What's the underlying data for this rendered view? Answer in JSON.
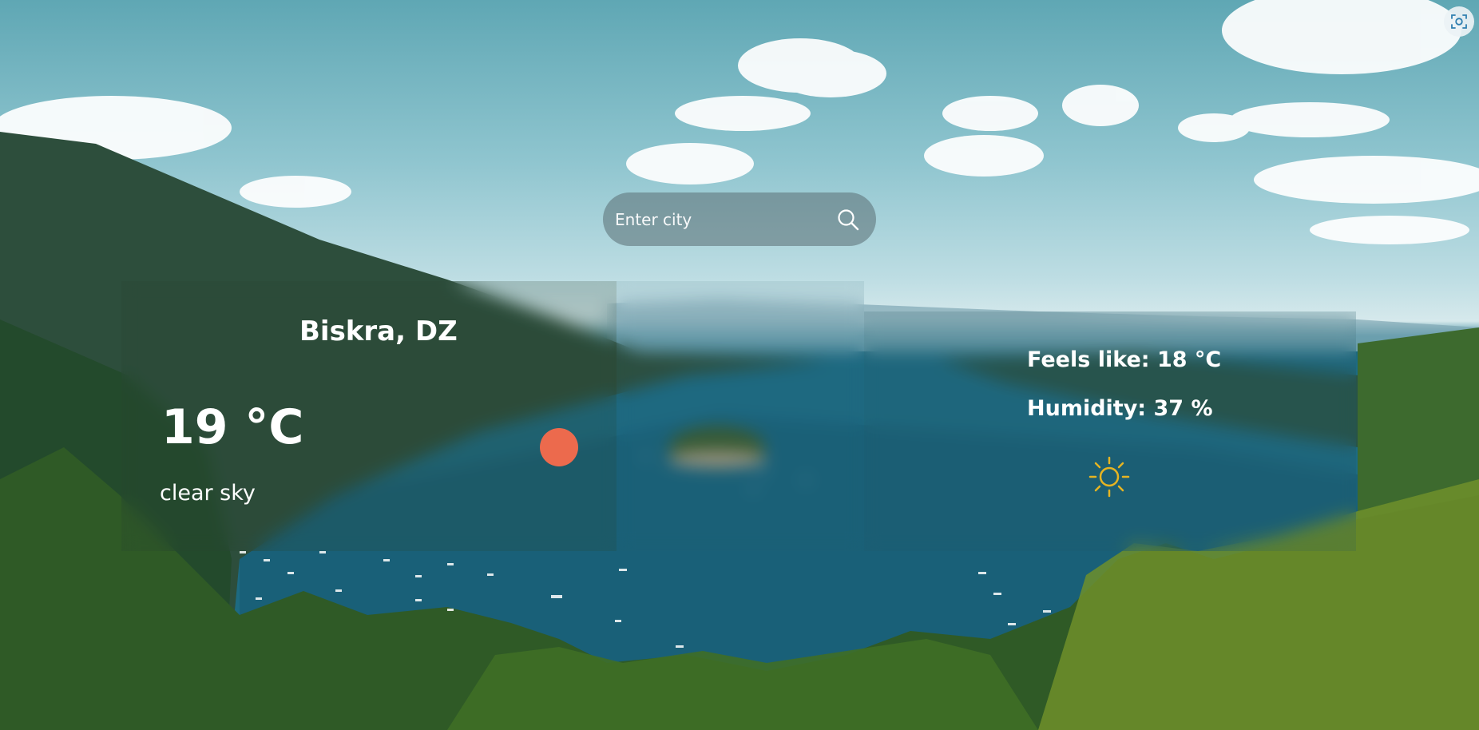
{
  "search": {
    "placeholder": "Enter city",
    "icon": "search-icon"
  },
  "weather": {
    "city": "Biskra, DZ",
    "temperature": "19 °C",
    "description": "clear sky",
    "feels_like": "Feels like: 18 °C",
    "humidity": "Humidity: 37 %",
    "icon": "sun-icon"
  },
  "colors": {
    "indicator_dot": "#ec6a4d",
    "sun_icon": "#e6b422",
    "text": "#ffffff"
  },
  "toolbar": {
    "capture_icon": "screen-capture-icon"
  }
}
